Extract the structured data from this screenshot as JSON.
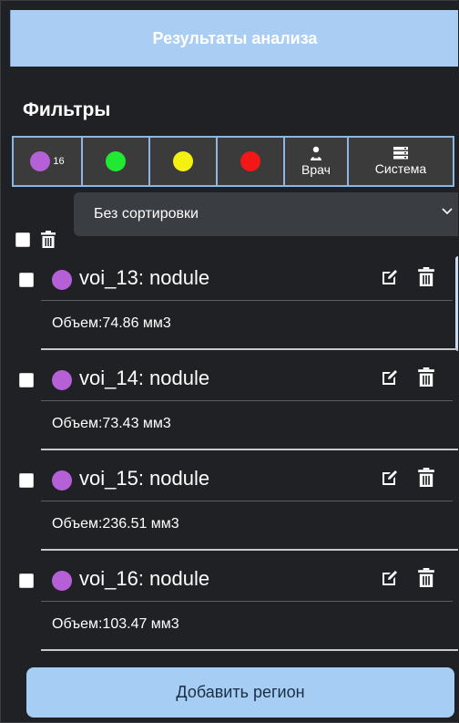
{
  "header": {
    "title": "Результаты анализа"
  },
  "filters": {
    "title": "Фильтры",
    "buttons": [
      {
        "color": "#b660d8",
        "count": "16"
      },
      {
        "color": "#21e832"
      },
      {
        "color": "#f4f012"
      },
      {
        "color": "#f31818"
      },
      {
        "label": "Врач",
        "icon": "doctor-icon"
      },
      {
        "label": "Система",
        "icon": "server-icon"
      }
    ]
  },
  "sort": {
    "selected": "Без сортировки"
  },
  "items": [
    {
      "title": "voi_13: nodule",
      "volume": "Объем:74.86 мм3",
      "color": "#b660d8"
    },
    {
      "title": "voi_14: nodule",
      "volume": "Объем:73.43 мм3",
      "color": "#b660d8"
    },
    {
      "title": "voi_15: nodule",
      "volume": "Объем:236.51 мм3",
      "color": "#b660d8"
    },
    {
      "title": "voi_16: nodule",
      "volume": "Объем:103.47 мм3",
      "color": "#b660d8"
    }
  ],
  "add_button": {
    "label": "Добавить регион"
  }
}
